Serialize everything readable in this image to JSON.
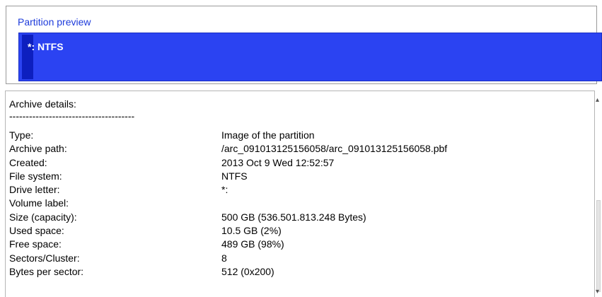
{
  "preview": {
    "title": "Partition preview",
    "partition_label": "*: NTFS"
  },
  "details": {
    "heading": "Archive details:",
    "separator": "--------------------------------------",
    "rows": [
      {
        "key": "Type:",
        "value": "Image of the partition"
      },
      {
        "key": "Archive path:",
        "value": "/arc_091013125156058/arc_091013125156058.pbf"
      },
      {
        "key": "Created:",
        "value": "2013 Oct 9 Wed 12:52:57"
      },
      {
        "key": "File system:",
        "value": "NTFS"
      },
      {
        "key": "Drive letter:",
        "value": "*:"
      },
      {
        "key": "Volume label:",
        "value": ""
      },
      {
        "key": "Size (capacity):",
        "value": "500 GB (536.501.813.248 Bytes)"
      },
      {
        "key": "Used space:",
        "value": "10.5 GB (2%)"
      },
      {
        "key": "Free space:",
        "value": "489 GB (98%)"
      },
      {
        "key": "Sectors/Cluster:",
        "value": "8"
      },
      {
        "key": "Bytes per sector:",
        "value": "512 (0x200)"
      }
    ]
  },
  "scrollbar": {
    "up_icon": "chevron-up-icon",
    "down_icon": "chevron-down-icon"
  }
}
